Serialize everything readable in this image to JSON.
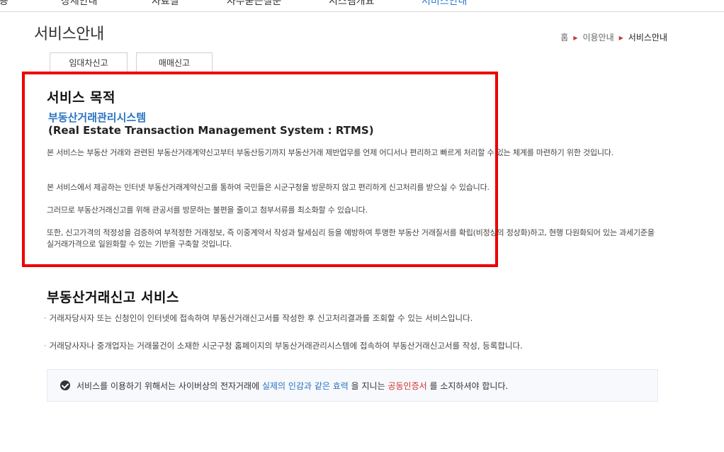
{
  "topnav": {
    "items": [
      "이용",
      "상세안내",
      "자료실",
      "자주묻는질문",
      "시스템개요",
      "서비스안내"
    ]
  },
  "page": {
    "title": "서비스안내"
  },
  "breadcrumb": {
    "home": "홈",
    "level1": "이용안내",
    "current": "서비스안내"
  },
  "tabs": [
    "임대차신고",
    "매매신고"
  ],
  "purpose": {
    "heading": "서비스 목적",
    "system_name": "부동산거래관리시스템",
    "system_en": "(Real Estate Transaction Management System : RTMS)",
    "paragraphs": [
      "본 서비스는 부동산 거래와 관련된 부동산거래계약신고부터 부동산등기까지 부동산거래 제반업무를 언제 어디서나 편리하고 빠르게 처리할 수 있는 체계를 마련하기 위한 것입니다.",
      "본 서비스에서 제공하는 인터넷 부동산거래계약신고를 통하여 국민들은 시군구청을 방문하지 않고 편리하게 신고처리를 받으실 수 있습니다.",
      "그러므로 부동산거래신고를 위해 관공서를 방문하는 불편을 줄이고 첨부서류를 최소화할 수 있습니다.",
      "또한, 신고가격의 적정성을 검증하여 부적정한 거래정보, 즉 이중계약서 작성과 탈세심리 등을 예방하여 투명한 부동산 거래질서를 확립(비정상의 정상화)하고, 현행 다원화되어 있는 과세기준을 실거래가격으로 일원화할 수 있는 기반을 구축할 것입니다."
    ]
  },
  "service": {
    "heading": "부동산거래신고 서비스",
    "items": [
      "거래자당사자 또는 신청인이 인터넷에 접속하여 부동산거래신고서를 작성한 후 신고처리결과를 조회할 수 있는 서비스입니다.",
      "거래당사자나 중개업자는 거래물건이 소재한 시군구청 홈페이지의 부동산거래관리시스템에 접속하여 부동산거래신고서를 작성, 등록합니다."
    ]
  },
  "notice": {
    "prefix": "서비스를 이용하기 위해서는 사이버상의 전자거래에",
    "highlight1": "실제의 인감과 같은 효력",
    "middle": "을 지니는",
    "highlight2": "공동인증서",
    "suffix": "를 소지하셔야 합니다.",
    "colors": {
      "highlight1": "#2a73c2",
      "highlight2": "#d0312d"
    }
  }
}
